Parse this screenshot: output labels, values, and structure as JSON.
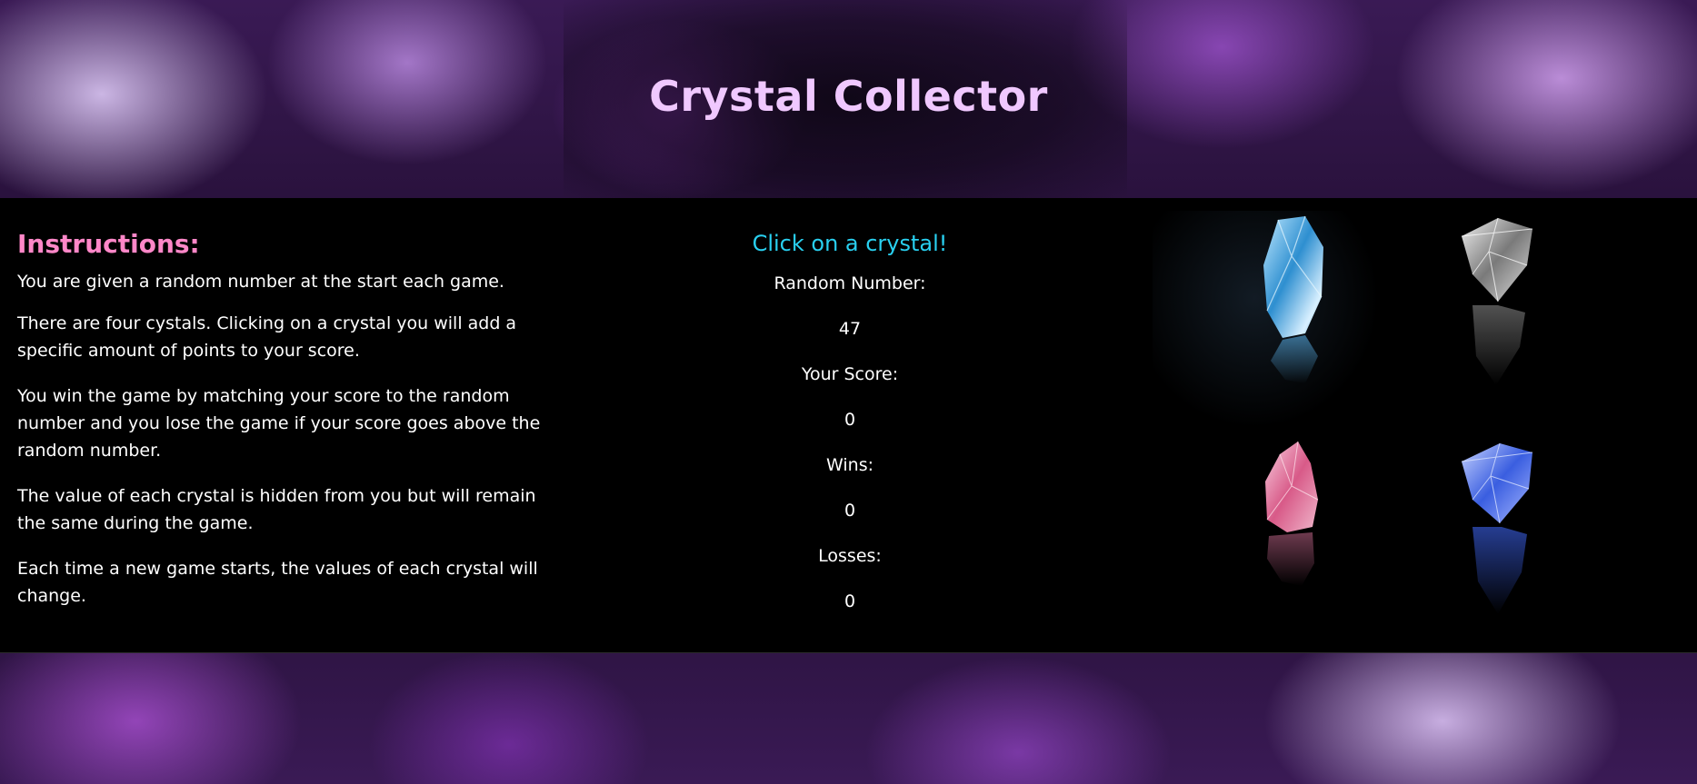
{
  "header": {
    "title": "Crystal Collector"
  },
  "instructions": {
    "heading": "Instructions:",
    "paragraphs": [
      "You are given a random number at the start each game.",
      "There are four cystals. Clicking on a crystal you will add a specific amount of points to your score.",
      "You win the game by matching your score to the random number and you lose the game if your score goes above the random number.",
      "The value of each crystal is hidden from you but will remain the same during the game.",
      "Each time a new game starts, the values of each crystal will change."
    ]
  },
  "game": {
    "prompt": "Click on a crystal!",
    "random_number_label": "Random Number:",
    "random_number": "47",
    "score_label": "Your Score:",
    "score": "0",
    "wins_label": "Wins:",
    "wins": "0",
    "losses_label": "Losses:",
    "losses": "0"
  },
  "crystals": [
    {
      "name": "blue-crystal",
      "color": "#3aa0d8"
    },
    {
      "name": "clear-crystal",
      "color": "#c8c8c8"
    },
    {
      "name": "pink-crystal",
      "color": "#e88aa8"
    },
    {
      "name": "sapphire-crystal",
      "color": "#4a6ee8"
    }
  ],
  "colors": {
    "title": "#f0c8ff",
    "instructions_heading": "#ff87c8",
    "prompt": "#29d0f0",
    "panel_background": "#000000"
  }
}
